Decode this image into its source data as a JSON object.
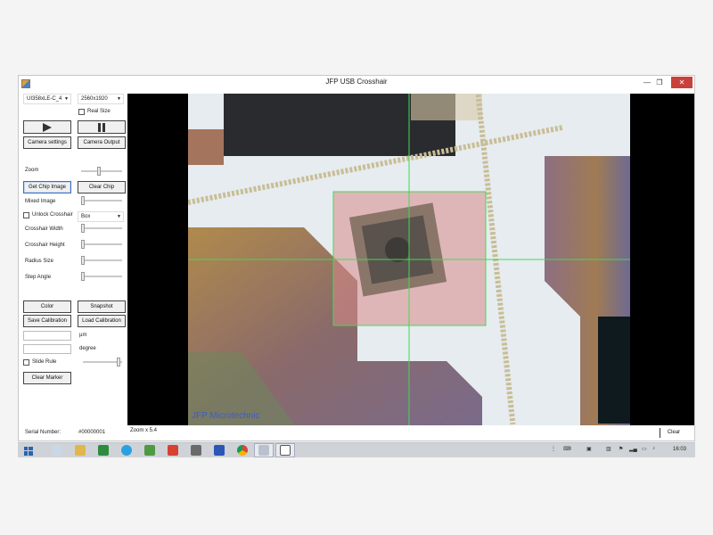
{
  "window": {
    "title": "JFP USB Crosshair",
    "minimize_glyph": "—",
    "maximize_glyph": "❐",
    "close_glyph": "✕"
  },
  "left_panel": {
    "camera_select": "UI358xLE-C_4",
    "resolution_select": "2560x1920",
    "real_size_label": "Real Size",
    "play_icon": "play-icon",
    "pause_icon": "pause-icon",
    "camera_settings_label": "Camera settings",
    "camera_output_label": "Camera Output",
    "zoom_label": "Zoom",
    "get_chip_image_label": "Get Chip Image",
    "clear_chip_label": "Clear Chip",
    "mixed_image_label": "Mixed Image",
    "unlock_crosshair_label": "Unlock Crosshair",
    "crosshair_type_select": "Box",
    "crosshair_width_label": "Crosshair Width",
    "crosshair_height_label": "Crosshair Height",
    "radius_size_label": "Radius Size",
    "step_angle_label": "Step Angle",
    "color_label": "Color",
    "snapshot_label": "Snapshot",
    "save_calibration_label": "Save Calibration",
    "load_calibration_label": "Load Calibration",
    "um_unit": "µm",
    "degree_unit": "degree",
    "slide_rule_label": "Slide Rule",
    "clear_marker_label": "Clear Marker",
    "serial_label": "Serial Number:",
    "serial_value": "#00000001"
  },
  "viewer": {
    "watermark": "JFP Microtechnic",
    "zoom_status": "Zoom x 5.4",
    "clear_label": "Clear",
    "crosshair_color": "#3ddc55",
    "overlay_color": "#d98b8b"
  },
  "taskbar": {
    "clock": "16:03",
    "icons": [
      "windows-icon",
      "explorer-icon",
      "file-manager-icon",
      "excel-icon",
      "skype-icon",
      "spreadsheet-icon",
      "pdf-icon",
      "game-icon",
      "pen-icon",
      "chrome-icon",
      "crosshair-app-icon",
      "active-window-icon"
    ]
  }
}
